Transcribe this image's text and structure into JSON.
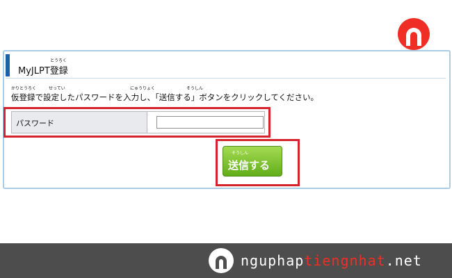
{
  "header": {
    "title": "MyJLPT登録",
    "title_ruby": "とうろく"
  },
  "instruction": {
    "text": "仮登録で設定したパスワードを入力し、「送信する」ボタンをクリックしてください。",
    "ruby_karitouroku": "かりとうろく",
    "ruby_settei": "せってい",
    "ruby_nyuuryoku": "にゅうりょく",
    "ruby_soushin": "そうしん"
  },
  "form": {
    "password_label": "パスワード",
    "password_value": "",
    "password_placeholder": ""
  },
  "submit": {
    "label": "送信する",
    "ruby": "そうしん"
  },
  "footer": {
    "site_part1": "nguphap",
    "site_part2": "tiengnhat",
    "site_part3": ".net"
  },
  "colors": {
    "accent_blue": "#1f5fa8",
    "panel_border": "#a9cde6",
    "highlight_red": "#d5222b",
    "button_green": "#62ad1a",
    "brand_red": "#ef2f25",
    "footer_bg": "#4d4d4d"
  }
}
